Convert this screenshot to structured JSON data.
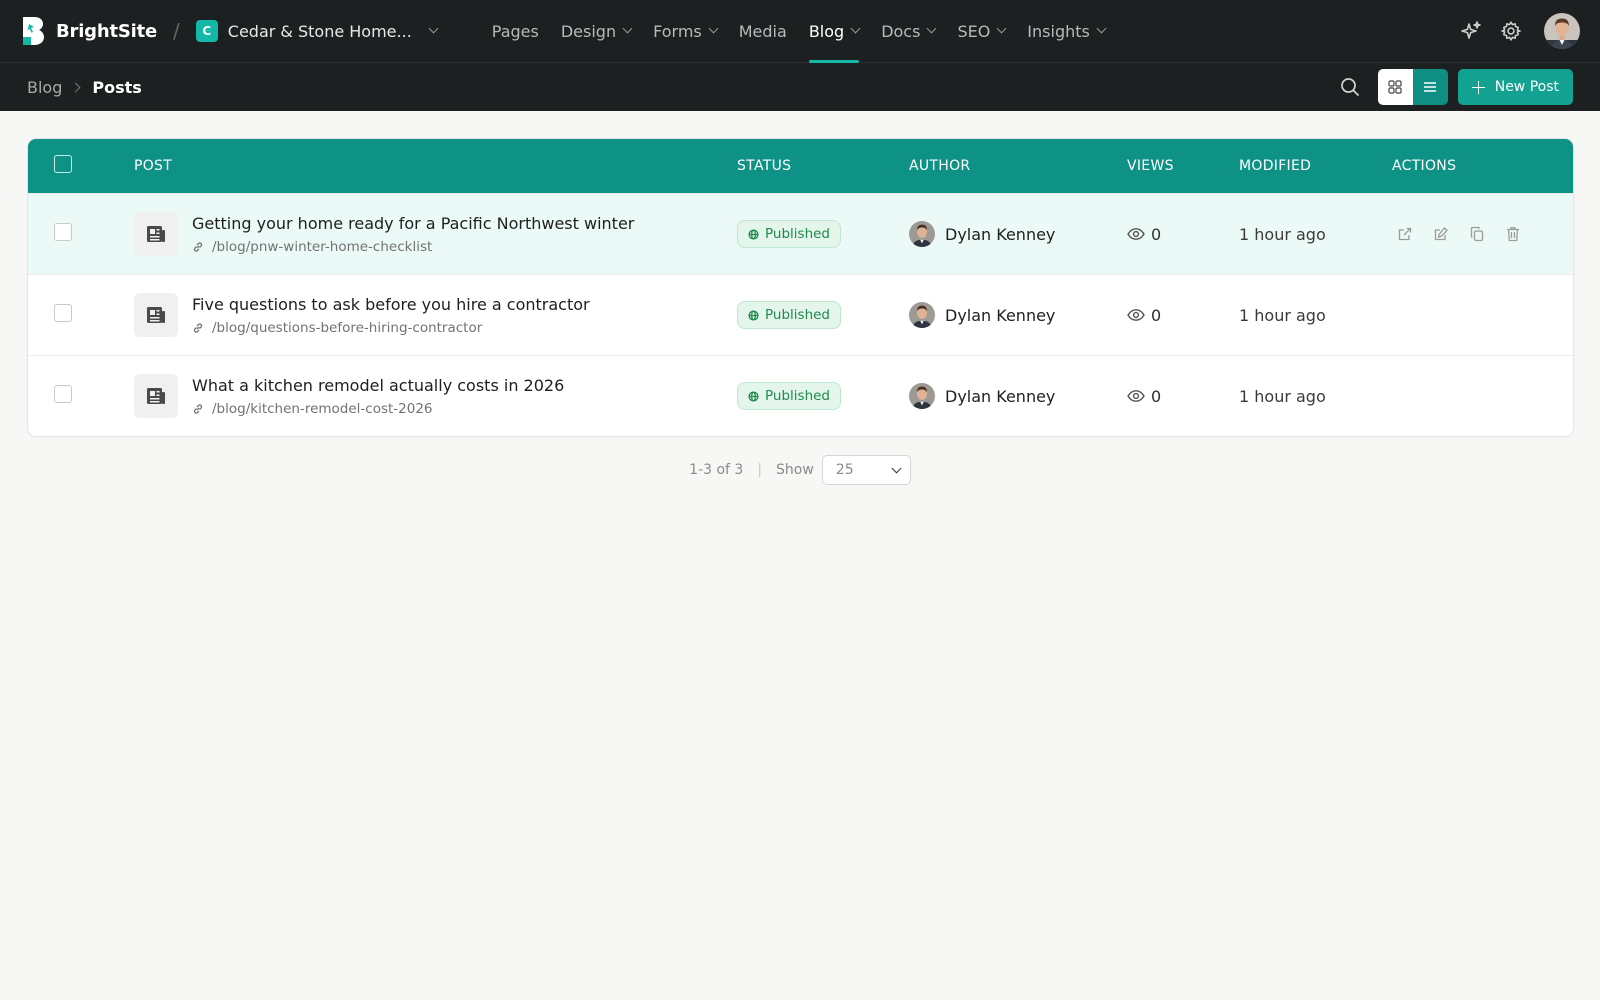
{
  "app": {
    "brand": "BrightSite",
    "site_initial": "C",
    "site_name": "Cedar & Stone Home..."
  },
  "nav": {
    "pages": "Pages",
    "design": "Design",
    "forms": "Forms",
    "media": "Media",
    "blog": "Blog",
    "docs": "Docs",
    "seo": "SEO",
    "insights": "Insights"
  },
  "breadcrumb": {
    "parent": "Blog",
    "current": "Posts"
  },
  "toolbar": {
    "new_post_label": "New Post"
  },
  "table": {
    "headers": {
      "post": "POST",
      "status": "STATUS",
      "author": "AUTHOR",
      "views": "VIEWS",
      "modified": "MODIFIED",
      "actions": "ACTIONS"
    },
    "rows": [
      {
        "title": "Getting your home ready for a Pacific Northwest winter",
        "slug": "/blog/pnw-winter-home-checklist",
        "status": "Published",
        "author": "Dylan Kenney",
        "views": "0",
        "modified": "1 hour ago"
      },
      {
        "title": "Five questions to ask before you hire a contractor",
        "slug": "/blog/questions-before-hiring-contractor",
        "status": "Published",
        "author": "Dylan Kenney",
        "views": "0",
        "modified": "1 hour ago"
      },
      {
        "title": "What a kitchen remodel actually costs in 2026",
        "slug": "/blog/kitchen-remodel-cost-2026",
        "status": "Published",
        "author": "Dylan Kenney",
        "views": "0",
        "modified": "1 hour ago"
      }
    ]
  },
  "pagination": {
    "range": "1-3 of 3",
    "separator": "|",
    "show_label": "Show",
    "per_page": "25"
  },
  "colors": {
    "accent": "#14b8a6",
    "header_teal": "#0e9285",
    "topbar": "#1d2021",
    "published_green": "#1e8a4c"
  }
}
